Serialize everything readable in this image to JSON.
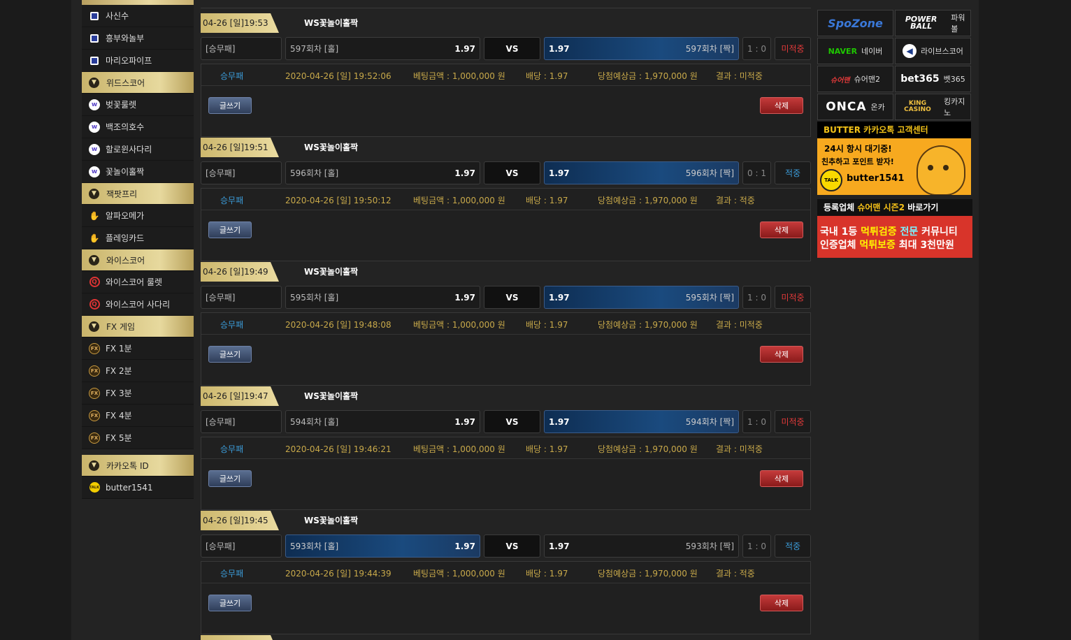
{
  "sidebar": {
    "items": [
      {
        "type": "item",
        "icon": "square-icon",
        "label": "사신수"
      },
      {
        "type": "item",
        "icon": "square-icon",
        "label": "흥부와놀부"
      },
      {
        "type": "item",
        "icon": "square-icon",
        "label": "마리오파이프"
      },
      {
        "type": "head",
        "label": "위드스코어"
      },
      {
        "type": "item",
        "icon": "w-icon",
        "label": "벚꽃룰렛"
      },
      {
        "type": "item",
        "icon": "w-icon",
        "label": "백조의호수"
      },
      {
        "type": "item",
        "icon": "w-icon",
        "label": "할로윈사다리"
      },
      {
        "type": "item",
        "icon": "w-icon",
        "label": "꽃놀이홀짝"
      },
      {
        "type": "head",
        "label": "잭팟프리"
      },
      {
        "type": "item",
        "icon": "hand-icon",
        "label": "알파오메가"
      },
      {
        "type": "item",
        "icon": "hand-icon",
        "label": "플레잉카드"
      },
      {
        "type": "head",
        "label": "와이스코어"
      },
      {
        "type": "item",
        "icon": "q-icon",
        "label": "와이스코어 룰렛"
      },
      {
        "type": "item",
        "icon": "q-icon",
        "label": "와이스코어 사다리"
      },
      {
        "type": "head",
        "label": "FX 게임"
      },
      {
        "type": "item",
        "icon": "fx-icon",
        "label": "FX 1분"
      },
      {
        "type": "item",
        "icon": "fx-icon",
        "label": "FX 2분"
      },
      {
        "type": "item",
        "icon": "fx-icon",
        "label": "FX 3분"
      },
      {
        "type": "item",
        "icon": "fx-icon",
        "label": "FX 4분"
      },
      {
        "type": "item",
        "icon": "fx-icon",
        "label": "FX 5분"
      }
    ],
    "kakao_head": "카카오톡 ID",
    "kakao_id": "butter1541",
    "kakao_icon_text": "TALK"
  },
  "bets": [
    {
      "date": "04-26 [일]19:53",
      "game": "WS꽃놀이홀짝",
      "type": "[승무패]",
      "home": "597회차 [홀]",
      "home_odds": "1.97",
      "vs": "VS",
      "away_odds": "1.97",
      "away": "597회차 [짝]",
      "selected": "away",
      "score": "1 : 0",
      "result": "미적중",
      "result_class": "miss",
      "info_type": "승무패",
      "info_time": "2020-04-26 [일] 19:52:06",
      "info_amount": "베팅금액 : 1,000,000 원",
      "info_odds": "배당 : 1.97",
      "info_expected": "당첨예상금 : 1,970,000 원",
      "info_result": "결과 : 미적중"
    },
    {
      "date": "04-26 [일]19:51",
      "game": "WS꽃놀이홀짝",
      "type": "[승무패]",
      "home": "596회차 [홀]",
      "home_odds": "1.97",
      "vs": "VS",
      "away_odds": "1.97",
      "away": "596회차 [짝]",
      "selected": "away",
      "score": "0 : 1",
      "result": "적중",
      "result_class": "hit",
      "info_type": "승무패",
      "info_time": "2020-04-26 [일] 19:50:12",
      "info_amount": "베팅금액 : 1,000,000 원",
      "info_odds": "배당 : 1.97",
      "info_expected": "당첨예상금 : 1,970,000 원",
      "info_result": "결과 : 적중"
    },
    {
      "date": "04-26 [일]19:49",
      "game": "WS꽃놀이홀짝",
      "type": "[승무패]",
      "home": "595회차 [홀]",
      "home_odds": "1.97",
      "vs": "VS",
      "away_odds": "1.97",
      "away": "595회차 [짝]",
      "selected": "away",
      "score": "1 : 0",
      "result": "미적중",
      "result_class": "miss",
      "info_type": "승무패",
      "info_time": "2020-04-26 [일] 19:48:08",
      "info_amount": "베팅금액 : 1,000,000 원",
      "info_odds": "배당 : 1.97",
      "info_expected": "당첨예상금 : 1,970,000 원",
      "info_result": "결과 : 미적중"
    },
    {
      "date": "04-26 [일]19:47",
      "game": "WS꽃놀이홀짝",
      "type": "[승무패]",
      "home": "594회차 [홀]",
      "home_odds": "1.97",
      "vs": "VS",
      "away_odds": "1.97",
      "away": "594회차 [짝]",
      "selected": "away",
      "score": "1 : 0",
      "result": "미적중",
      "result_class": "miss",
      "info_type": "승무패",
      "info_time": "2020-04-26 [일] 19:46:21",
      "info_amount": "베팅금액 : 1,000,000 원",
      "info_odds": "배당 : 1.97",
      "info_expected": "당첨예상금 : 1,970,000 원",
      "info_result": "결과 : 미적중"
    },
    {
      "date": "04-26 [일]19:45",
      "game": "WS꽃놀이홀짝",
      "type": "[승무패]",
      "home": "593회차 [홀]",
      "home_odds": "1.97",
      "vs": "VS",
      "away_odds": "1.97",
      "away": "593회차 [짝]",
      "selected": "home",
      "score": "1 : 0",
      "result": "적중",
      "result_class": "hit",
      "info_type": "승무패",
      "info_time": "2020-04-26 [일] 19:44:39",
      "info_amount": "베팅금액 : 1,000,000 원",
      "info_odds": "배당 : 1.97",
      "info_expected": "당첨예상금 : 1,970,000 원",
      "info_result": "결과 : 적중"
    }
  ],
  "buttons": {
    "write": "글쓰기",
    "delete": "삭제"
  },
  "partners": [
    {
      "logo": "SpoZone",
      "label": ""
    },
    {
      "logo": "POWER BALL",
      "label": "파워볼"
    },
    {
      "logo": "NAVER",
      "label": "네이버"
    },
    {
      "logo": "",
      "label": "라이브스코어"
    },
    {
      "logo": "슈어맨",
      "label": "슈어맨2"
    },
    {
      "logo": "bet365",
      "label": "벳365"
    },
    {
      "logo": "ONCA",
      "label": "온카"
    },
    {
      "logo": "KING CASINO",
      "label": "킹카지노"
    }
  ],
  "banner_kakao": {
    "title": "BUTTER 카카오톡 고객센터",
    "line1": "24시 항시 대기중!",
    "line2": "친추하고 포인트 받자!",
    "badge": "TALK",
    "id": "butter1541"
  },
  "banner_sureman": {
    "title_pre": "등록업체 ",
    "title_hl": "슈어맨 시즌2",
    "title_post": " 바로가기",
    "l1_a": "국내 1등 ",
    "l1_b": "먹튀검증",
    "l1_c": " 전문",
    "l1_d": " 커뮤니티",
    "l2_a": "인증업체 ",
    "l2_b": "먹튀보증",
    "l2_c": " 최대 3천만원"
  }
}
